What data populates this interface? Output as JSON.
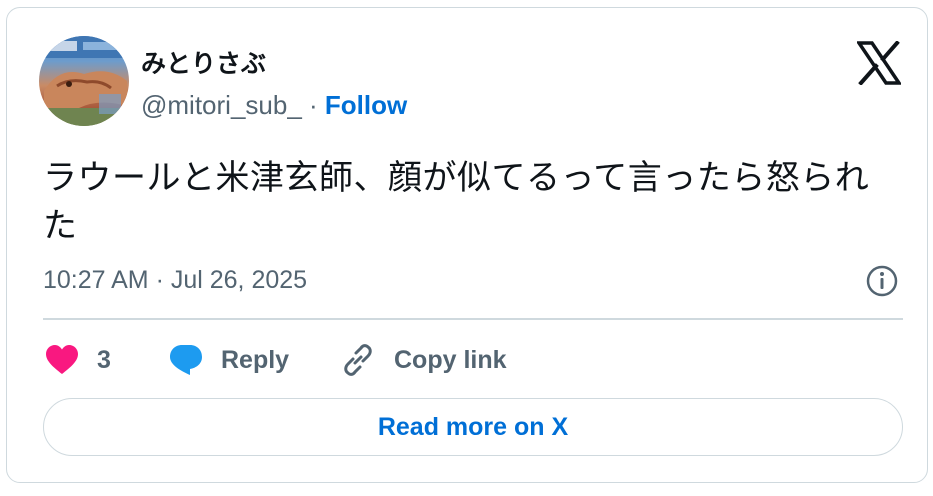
{
  "author": {
    "name": "みとりさぶ",
    "handle": "@mitori_sub_",
    "separator": " · ",
    "follow_label": "Follow",
    "avatar_icon": "profile-photo"
  },
  "brand_icon": "x-logo-icon",
  "tweet": {
    "text": "ラウールと米津玄師、顔が似てるって言ったら怒られた",
    "timestamp": "10:27 AM · Jul 26, 2025"
  },
  "actions": {
    "like_count": "3",
    "reply_label": "Reply",
    "copy_link_label": "Copy link"
  },
  "read_more_label": "Read more on X",
  "colors": {
    "link_blue": "#006fd6",
    "like_pink": "#f91880",
    "reply_blue": "#1d9bf0",
    "secondary_text": "#536471",
    "border": "#cfd9de"
  }
}
